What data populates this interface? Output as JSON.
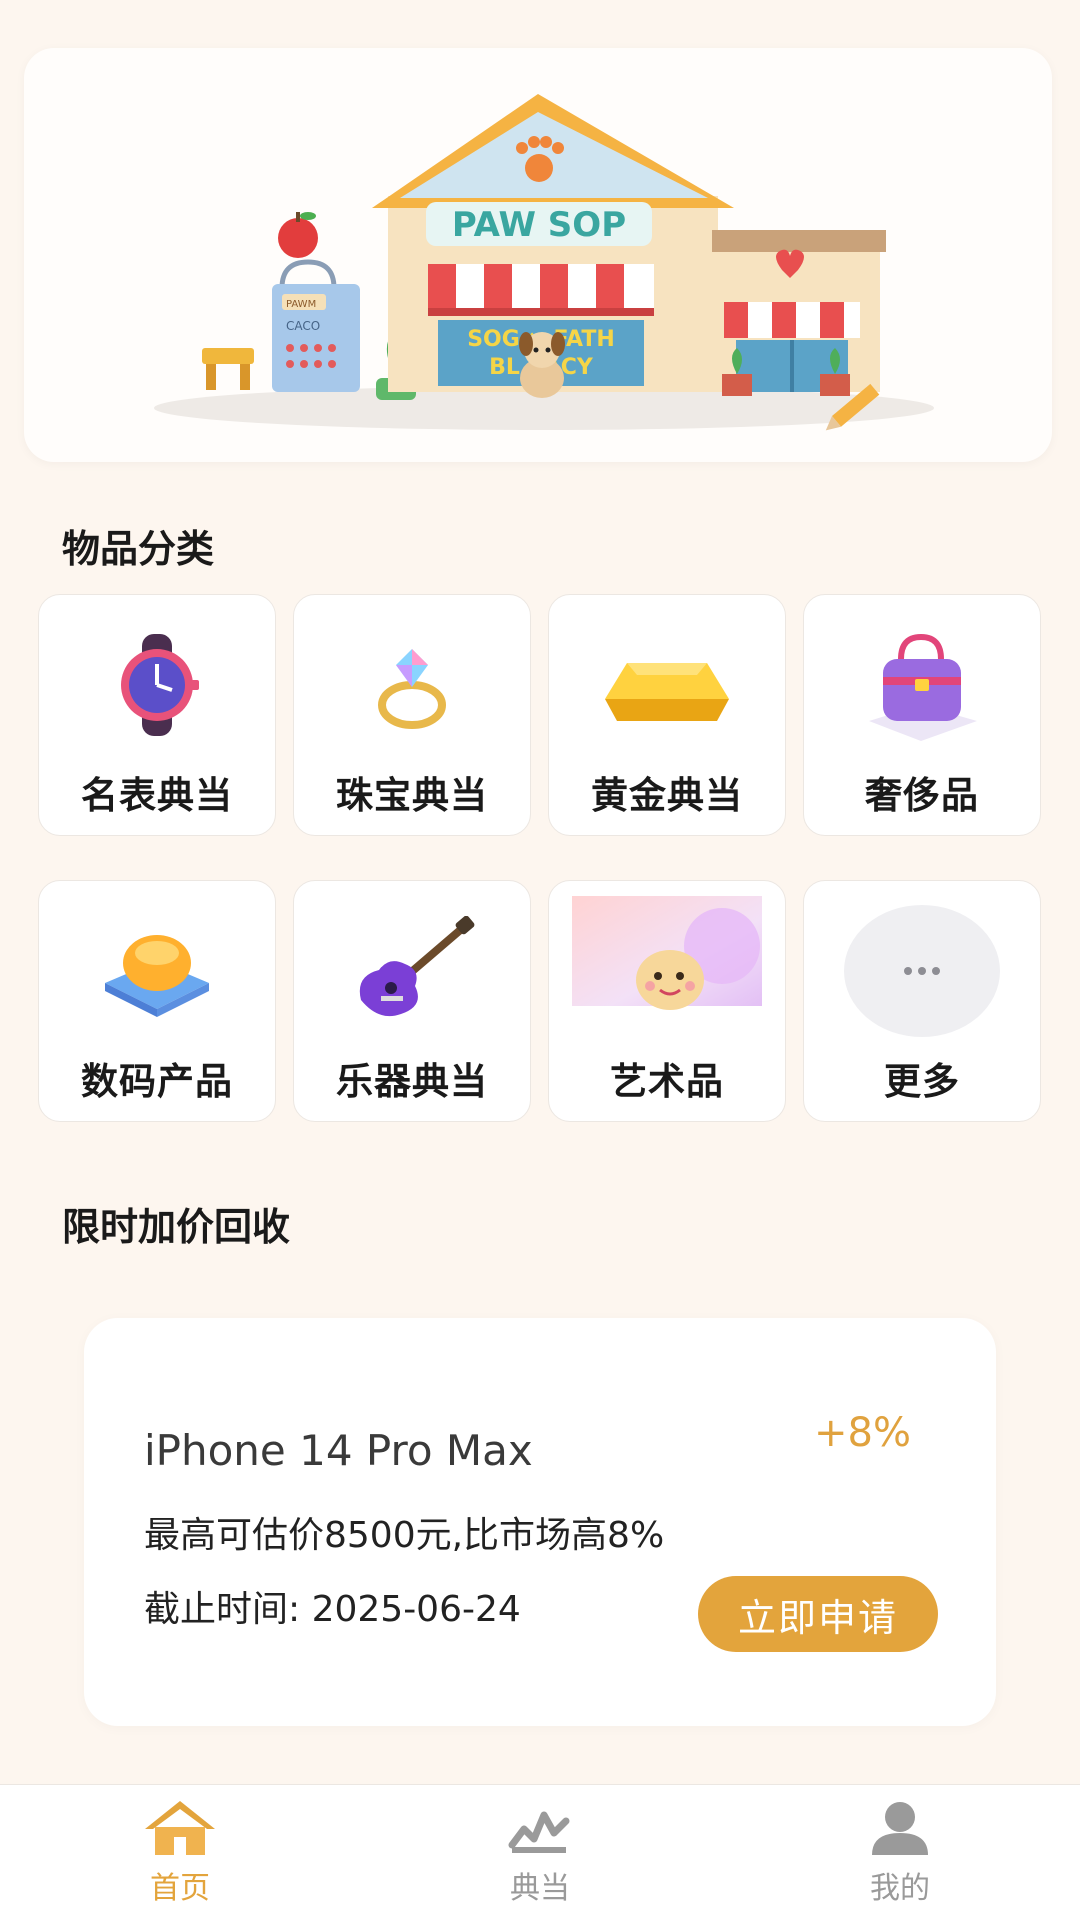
{
  "banner": {
    "shop_sign": "PAW SOP",
    "window_line1": "SOG × FATH",
    "window_line2": "BL  CACY",
    "bag_tag_top": "PAWM",
    "bag_tag_bottom": "CACO"
  },
  "categories": {
    "title": "物品分类",
    "items": [
      {
        "label": "名表典当",
        "icon": "watch-icon"
      },
      {
        "label": "珠宝典当",
        "icon": "diamond-ring-icon"
      },
      {
        "label": "黄金典当",
        "icon": "gold-bar-icon"
      },
      {
        "label": "奢侈品",
        "icon": "handbag-icon"
      },
      {
        "label": "数码产品",
        "icon": "digital-device-icon"
      },
      {
        "label": "乐器典当",
        "icon": "guitar-icon"
      },
      {
        "label": "艺术品",
        "icon": "art-sculpture-icon"
      },
      {
        "label": "更多",
        "icon": "more-dots-icon"
      }
    ]
  },
  "promo": {
    "title": "限时加价回收",
    "product": "iPhone 14 Pro Max",
    "bonus": "+8%",
    "description": "最高可估价8500元,比市场高8%",
    "deadline": "截止时间: 2025-06-24",
    "apply_label": "立即申请"
  },
  "tabbar": {
    "items": [
      {
        "label": "首页",
        "icon": "home-icon",
        "active": true
      },
      {
        "label": "典当",
        "icon": "chart-icon",
        "active": false
      },
      {
        "label": "我的",
        "icon": "user-icon",
        "active": false
      }
    ]
  },
  "colors": {
    "accent": "#e3a43c",
    "background": "#fdf6ef",
    "card": "#ffffff"
  }
}
